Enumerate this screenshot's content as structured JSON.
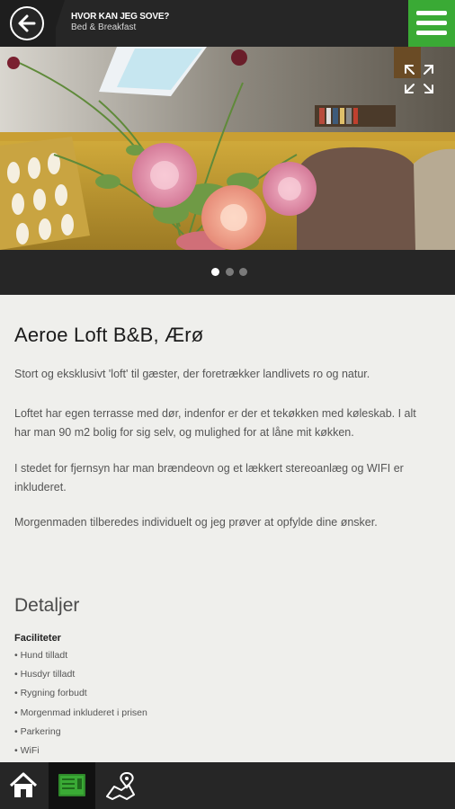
{
  "header": {
    "title": "HVOR KAN JEG SOVE?",
    "subtitle": "Bed & Breakfast",
    "accent": "#3aaa35"
  },
  "gallery": {
    "slides": 3,
    "active_slide": 1
  },
  "listing": {
    "title": "Aeroe Loft B&B, Ærø",
    "paragraphs": [
      "Stort og eksklusivt 'loft' til gæster, der foretrækker landlivets ro og natur.",
      "Loftet har egen terrasse med dør, indenfor er der et tekøkken med køleskab. I alt har man 90 m2 bolig for sig selv, og mulighed for at låne mit køkken.",
      "I stedet for fjernsyn har man brændeovn og et lækkert stereoanlæg og WIFI er inkluderet.",
      "Morgenmaden tilberedes individuelt og jeg prøver at opfylde dine ønsker."
    ]
  },
  "details": {
    "title": "Detaljer",
    "facilities_label": "Faciliteter",
    "facilities": [
      "• Hund tilladt",
      "• Husdyr tilladt",
      "• Rygning forbudt",
      "• Morgenmad inkluderet i prisen",
      "• Parkering",
      "• WiFi"
    ]
  },
  "bottom_nav": {
    "items": [
      "home-icon",
      "guide-book-icon",
      "map-icon"
    ],
    "active": 1
  }
}
